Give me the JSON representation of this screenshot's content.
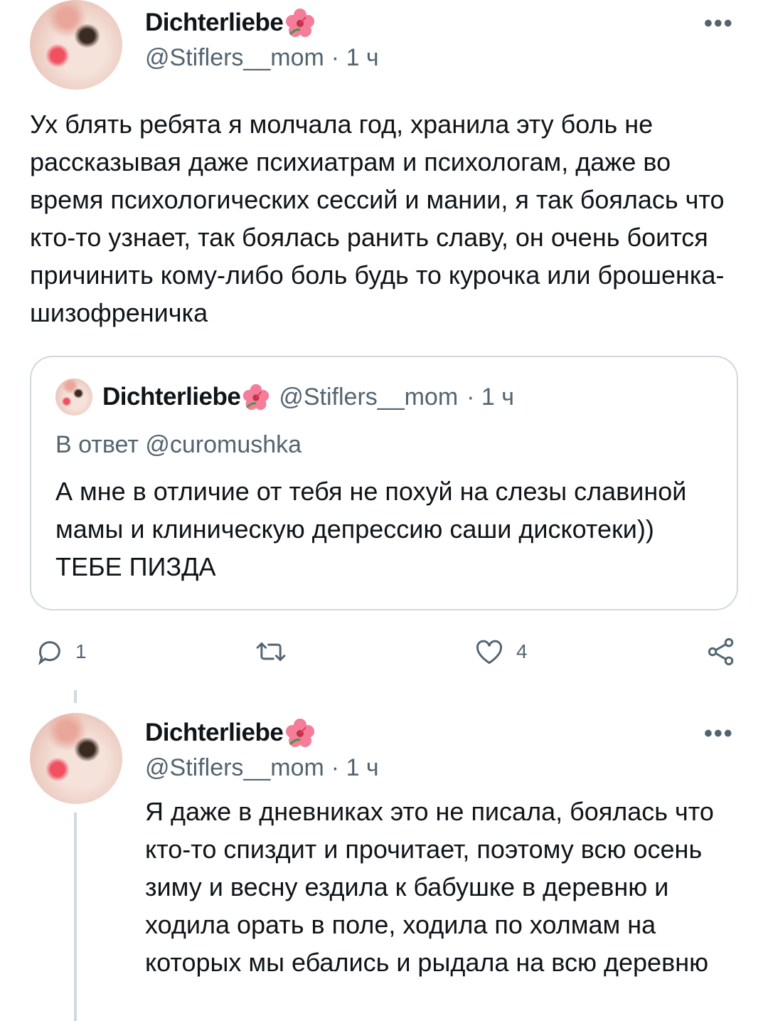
{
  "tweet_main": {
    "display_name": "Dichterliebe",
    "handle": "@Stiflers__mom",
    "time": "· 1 ч",
    "more": "•••",
    "text": "Ух блять ребята я молчала год, хранила эту боль не рассказывая даже психиатрам и психологам, даже во время психологических сессий и мании, я так боялась что кто-то узнает, так боялась ранить славу, он очень боится причинить кому-либо боль будь то курочка или брошенка-шизофреничка"
  },
  "quoted": {
    "display_name": "Dichterliebe",
    "handle": "@Stiflers__mom",
    "time": "· 1 ч",
    "reply_to": "В ответ @curomushka",
    "text": "А мне в отличие от тебя не похуй на слезы славиной мамы и клиническую депрессию саши дискотеки)) ТЕБЕ ПИЗДА"
  },
  "actions": {
    "reply_count": "1",
    "retweet_count": "",
    "like_count": "4"
  },
  "tweet_reply": {
    "display_name": "Dichterliebe",
    "handle": "@Stiflers__mom",
    "time": "· 1 ч",
    "more": "•••",
    "text": "Я даже в дневниках это не писала, боялась что кто-то спиздит и прочитает, поэтому всю осень зиму и весну ездила к бабушке в деревню и ходила орать в поле, ходила по холмам на которых мы ебались и рыдала на всю деревню"
  },
  "colors": {
    "text": "#0f1419",
    "secondary": "#536471",
    "border": "#cfd9de",
    "flower": "#f47d9a"
  },
  "icons": [
    "hibiscus-emoji-icon",
    "reply-icon",
    "retweet-icon",
    "like-icon",
    "share-icon",
    "more-icon"
  ]
}
